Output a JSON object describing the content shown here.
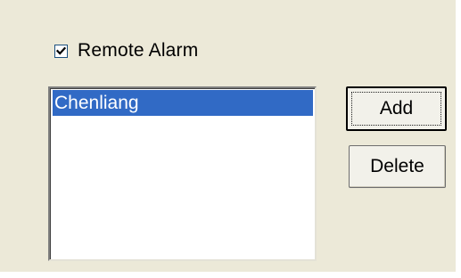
{
  "remote_alarm": {
    "label": "Remote Alarm",
    "checked": true
  },
  "list": {
    "items": [
      {
        "label": "Chenliang",
        "selected": true
      }
    ]
  },
  "buttons": {
    "add_label": "Add",
    "delete_label": "Delete"
  },
  "colors": {
    "dialog_background": "#ece9d8",
    "selection_highlight": "#316ac5",
    "list_background": "#ffffff"
  }
}
